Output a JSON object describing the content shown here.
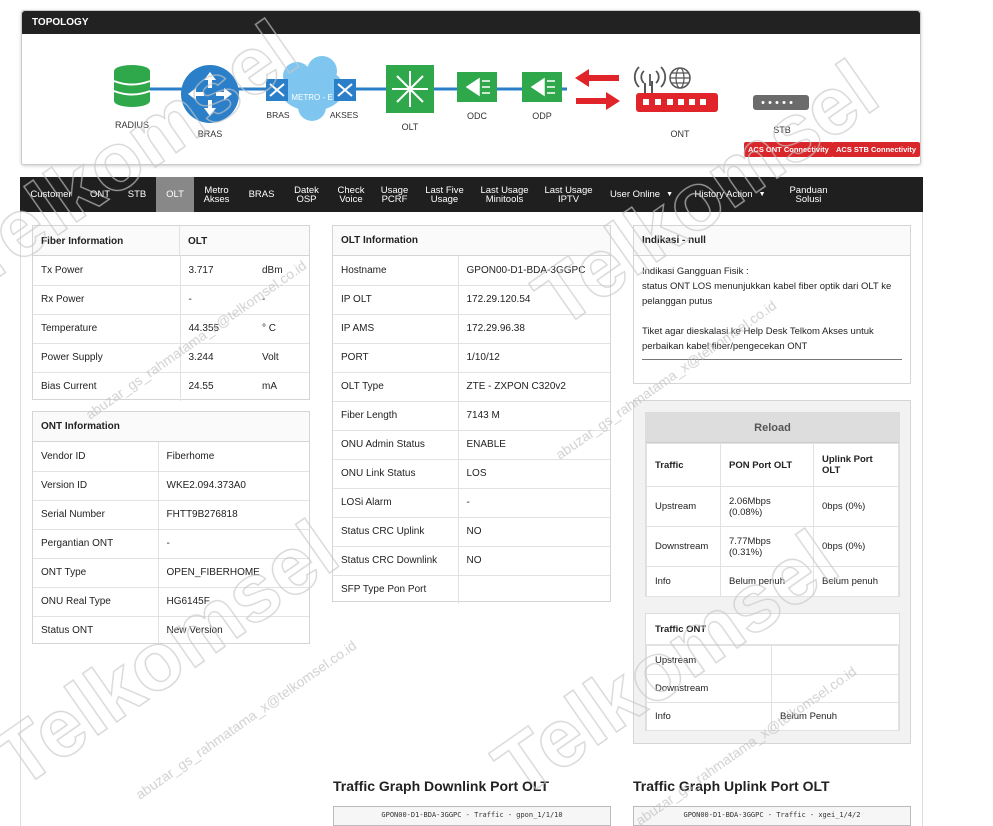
{
  "topology": {
    "title": "TOPOLOGY",
    "nodes": {
      "radius": "RADIUS",
      "bras": "BRAS",
      "metro_left": "BRAS",
      "metro_cloud": "METRO - E",
      "metro_right": "AKSES",
      "olt": "OLT",
      "odc": "ODC",
      "odp": "ODP",
      "ont": "ONT",
      "stb": "STB"
    },
    "acs_ont": "ACS ONT Connectivity",
    "acs_stb": "ACS STB Connectivity"
  },
  "tabs": [
    {
      "label": "Customer"
    },
    {
      "label": "ONT"
    },
    {
      "label": "STB"
    },
    {
      "label": "OLT",
      "active": true
    },
    {
      "label": "Metro\nAkses"
    },
    {
      "label": "BRAS"
    },
    {
      "label": "Datek\nOSP"
    },
    {
      "label": "Check\nVoice"
    },
    {
      "label": "Usage\nPCRF"
    },
    {
      "label": "Last Five\nUsage"
    },
    {
      "label": "Last Usage\nMinitools"
    },
    {
      "label": "Last Usage\nIPTV"
    },
    {
      "label": "User Online",
      "dropdown": true
    },
    {
      "label": "History Action",
      "dropdown": true
    },
    {
      "label": "Panduan\nSolusi"
    }
  ],
  "fiber": {
    "header_left": "Fiber Information",
    "header_right": "OLT",
    "rows": [
      {
        "label": "Tx Power",
        "value": "3.717",
        "unit": "dBm"
      },
      {
        "label": "Rx Power",
        "value": "-",
        "unit": "-"
      },
      {
        "label": "Temperature",
        "value": "44.355",
        "unit": "° C"
      },
      {
        "label": "Power Supply",
        "value": "3.244",
        "unit": "Volt"
      },
      {
        "label": "Bias Current",
        "value": "24.55",
        "unit": "mA"
      }
    ]
  },
  "ont_info": {
    "title": "ONT Information",
    "rows": [
      {
        "label": "Vendor ID",
        "value": "Fiberhome"
      },
      {
        "label": "Version ID",
        "value": "WKE2.094.373A0"
      },
      {
        "label": "Serial Number",
        "value": "FHTT9B276818"
      },
      {
        "label": "Pergantian ONT",
        "value": "-"
      },
      {
        "label": "ONT Type",
        "value": "OPEN_FIBERHOME"
      },
      {
        "label": "ONU Real Type",
        "value": "HG6145F"
      },
      {
        "label": "Status ONT",
        "value": "New Version"
      }
    ]
  },
  "olt_info": {
    "title": "OLT Information",
    "rows": [
      {
        "label": "Hostname",
        "value": "GPON00-D1-BDA-3GGPC"
      },
      {
        "label": "IP OLT",
        "value": "172.29.120.54"
      },
      {
        "label": "IP AMS",
        "value": "172.29.96.38"
      },
      {
        "label": "PORT",
        "value": "1/10/12"
      },
      {
        "label": "OLT Type",
        "value": "ZTE - ZXPON C320v2"
      },
      {
        "label": "Fiber Length",
        "value": "7143 M"
      },
      {
        "label": "ONU Admin Status",
        "value": "ENABLE"
      },
      {
        "label": "ONU Link Status",
        "value": "LOS"
      },
      {
        "label": "LOSi Alarm",
        "value": "-"
      },
      {
        "label": "Status CRC Uplink",
        "value": "NO"
      },
      {
        "label": "Status CRC Downlink",
        "value": "NO"
      },
      {
        "label": "SFP Type Pon Port",
        "value": ""
      }
    ]
  },
  "indikasi": {
    "title": "Indikasi - null",
    "line1": "Indikasi Gangguan Fisik :",
    "line2": "status ONT LOS menunjukkan kabel fiber optik dari OLT ke pelanggan putus",
    "line3": "Tiket agar dieskalasi ke Help Desk Telkom Akses untuk perbaikan kabel fiber/pengecekan ONT"
  },
  "traffic": {
    "reload": "Reload",
    "headers": [
      "Traffic",
      "PON Port OLT",
      "Uplink Port OLT"
    ],
    "rows": [
      {
        "label": "Upstream",
        "pon": "2.06Mbps (0.08%)",
        "uplink": "0bps (0%)"
      },
      {
        "label": "Downstream",
        "pon": "7.77Mbps (0.31%)",
        "uplink": "0bps (0%)"
      },
      {
        "label": "Info",
        "pon": "Belum penuh",
        "uplink": "Belum penuh"
      }
    ]
  },
  "traffic_ont": {
    "title": "Traffic ONT",
    "rows": [
      {
        "label": "Upstream",
        "value": ""
      },
      {
        "label": "Downstream",
        "value": ""
      },
      {
        "label": "Info",
        "value": "Belum Penuh"
      }
    ]
  },
  "graphs": {
    "downlink_title": "Traffic Graph Downlink Port OLT",
    "uplink_title": "Traffic Graph Uplink Port OLT",
    "downlink_caption": "GPON00-D1-BDA-3GGPC - Traffic - gpon_1/1/10",
    "uplink_caption": "GPON00-D1-BDA-3GGPC - Traffic - xgei_1/4/2"
  },
  "watermark": {
    "brand": "Telkomsel",
    "user": "abuzar_gs_rahmatama_x@telkomsel.co.id"
  }
}
